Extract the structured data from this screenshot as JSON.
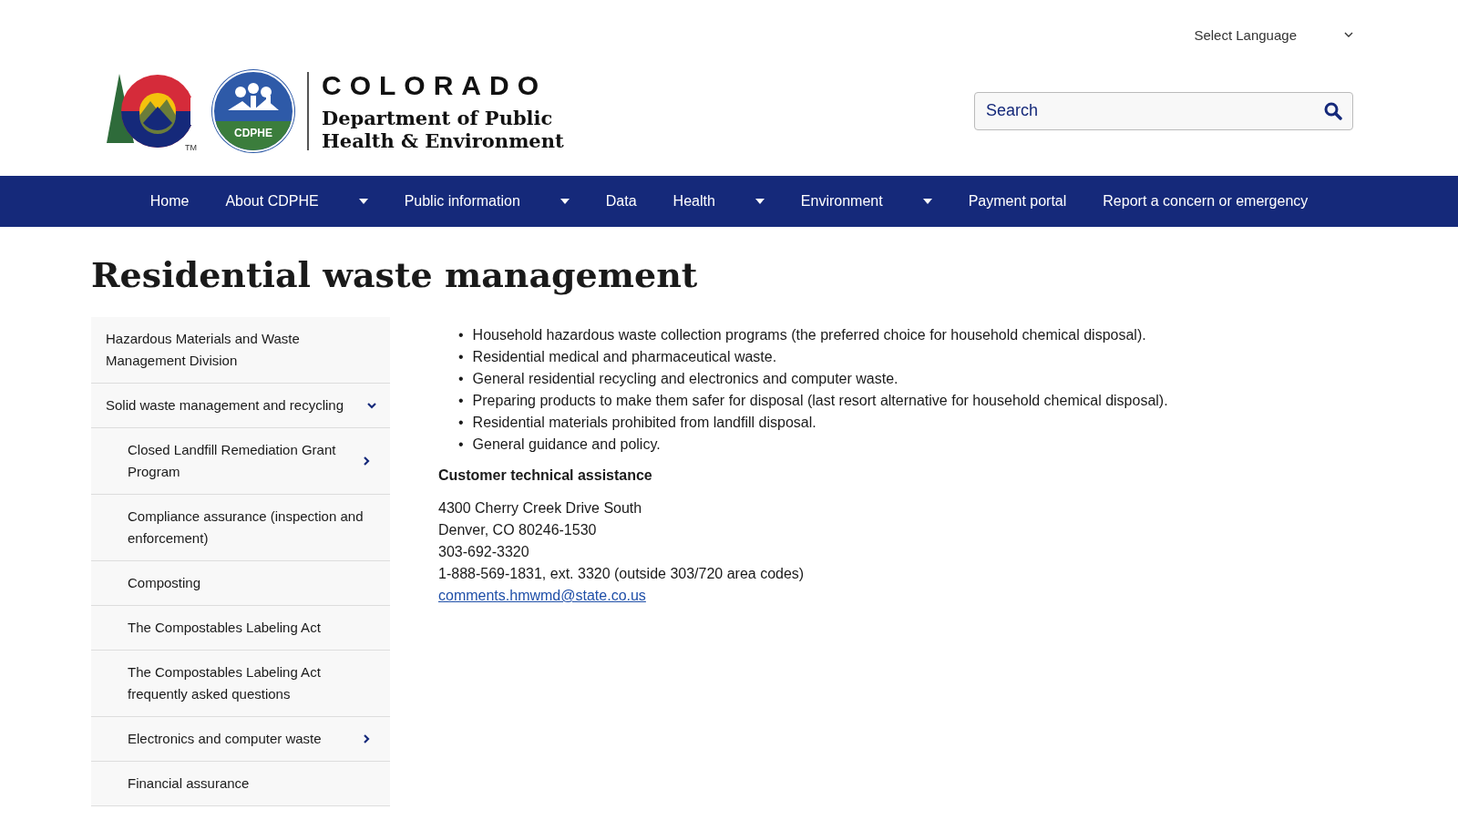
{
  "language_select": {
    "label": "Select Language"
  },
  "logo": {
    "wordmark": "COLORADO",
    "department": [
      "Department of Public",
      "Health & Environment"
    ],
    "badge_text": "CDPHE",
    "trademark": "TM"
  },
  "search": {
    "placeholder": "Search"
  },
  "nav": [
    {
      "label": "Home",
      "has_menu": false
    },
    {
      "label": "About CDPHE",
      "has_menu": true
    },
    {
      "label": "Public information",
      "has_menu": true
    },
    {
      "label": "Data",
      "has_menu": false
    },
    {
      "label": "Health",
      "has_menu": true
    },
    {
      "label": "Environment",
      "has_menu": true
    },
    {
      "label": "Payment portal",
      "has_menu": false
    },
    {
      "label": "Report a concern or emergency",
      "has_menu": false
    }
  ],
  "page_title": "Residential waste management",
  "sidebar": {
    "items": [
      {
        "label": "Hazardous Materials and Waste Management Division",
        "kind": "link"
      },
      {
        "label": "Solid waste management and recycling",
        "kind": "branch",
        "expanded": true,
        "children": [
          {
            "label": "Closed Landfill Remediation Grant Program",
            "kind": "branch",
            "expanded": false
          },
          {
            "label": "Compliance assurance (inspection and enforcement)",
            "kind": "link"
          },
          {
            "label": "Composting",
            "kind": "link"
          },
          {
            "label": "The Compostables Labeling Act",
            "kind": "link"
          },
          {
            "label": "The Compostables Labeling Act frequently asked questions",
            "kind": "link"
          },
          {
            "label": "Electronics and computer waste",
            "kind": "branch",
            "expanded": false
          },
          {
            "label": "Financial assurance",
            "kind": "link"
          }
        ]
      }
    ]
  },
  "content": {
    "bullets": [
      {
        "marker": "•",
        "text": "Household hazardous waste collection programs (the preferred choice for household chemical disposal)."
      },
      {
        "marker": "•",
        "text": "Residential medical and pharmaceutical waste."
      },
      {
        "marker": "•",
        "text": "General residential recycling and electronics and computer waste."
      },
      {
        "marker": "•",
        "text": "Preparing products to make them safer for disposal (last resort alternative for household chemical disposal)."
      },
      {
        "marker": "•",
        "text": "Residential materials prohibited from landfill disposal."
      },
      {
        "marker": "•",
        "text": "General guidance and policy."
      }
    ],
    "contact_heading": "Customer technical assistance",
    "address_lines": [
      "4300 Cherry Creek Drive South",
      "Denver, CO 80246-1530",
      "303-692-3320",
      "1-888-569-1831, ext. 3320 (outside 303/720 area codes)"
    ],
    "email": "comments.hmwmd@state.co.us"
  }
}
